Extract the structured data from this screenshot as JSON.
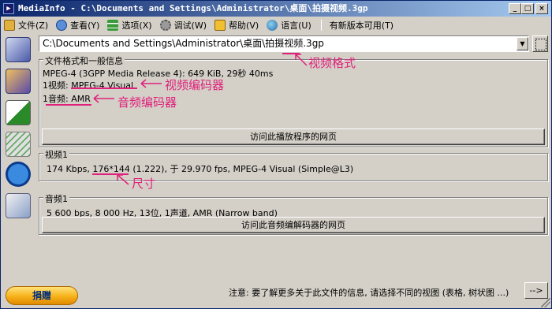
{
  "window": {
    "title": "MediaInfo - C:\\Documents and Settings\\Administrator\\桌面\\拍摄视频.3gp",
    "minimize": "_",
    "maximize": "□",
    "close": "×"
  },
  "menu": {
    "items": [
      {
        "label": "文件(Z)",
        "icon": "folder-icon",
        "color": "#c89a3a"
      },
      {
        "label": "查看(Y)",
        "icon": "eye-icon",
        "color": "#4a7ec8"
      },
      {
        "label": "选项(X)",
        "icon": "options-icon",
        "color": "#3a9a3a"
      },
      {
        "label": "调试(W)",
        "icon": "debug-icon",
        "color": "#8a8a8a"
      },
      {
        "label": "帮助(V)",
        "icon": "help-icon",
        "color": "#d4a020"
      },
      {
        "label": "语言(U)",
        "icon": "globe-icon",
        "color": "#3a8ac8"
      }
    ],
    "new_version": "有新版本可用(T)"
  },
  "path": {
    "value": "C:\\Documents and Settings\\Administrator\\桌面\\拍摄视频.3gp"
  },
  "general": {
    "title": "文件格式和一般信息",
    "format_line": "MPEG-4 (3GPP Media Release 4): 649 KiB, 29秒 40ms",
    "video_line": "1视频: MPEG-4 Visual",
    "audio_line": "1音频: AMR",
    "button": "访问此播放程序的网页"
  },
  "video": {
    "title": "视频1",
    "info_line": "174 Kbps, 176*144 (1.222), 于 29.970 fps, MPEG-4 Visual (Simple@L3)"
  },
  "audio": {
    "title": "音频1",
    "info_line": "5 600 bps, 8 000 Hz, 13位, 1声道, AMR (Narrow band)",
    "button": "访问此音频编解码器的网页"
  },
  "annotations": {
    "format": "视频格式",
    "video_codec": "视频编码器",
    "audio_codec": "音频编码器",
    "size": "尺寸",
    "color": "#e0207a"
  },
  "footer": {
    "donate": "捐赠",
    "note": "注意: 要了解更多关于此文件的信息, 请选择不同的视图 (表格, 树状图 ...)",
    "next": "-->"
  }
}
